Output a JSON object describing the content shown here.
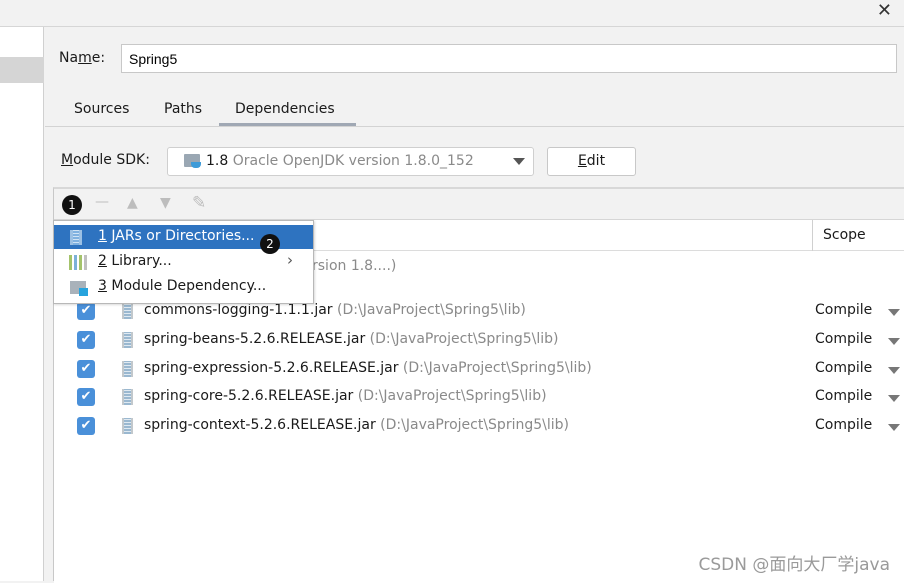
{
  "window": {
    "close_label": "✕"
  },
  "name": {
    "label_pre": "Na",
    "label_u": "m",
    "label_post": "e:",
    "value": "Spring5"
  },
  "tabs": [
    {
      "label": "Sources"
    },
    {
      "label": "Paths"
    },
    {
      "label": "Dependencies",
      "active": true
    }
  ],
  "sdk": {
    "label_u": "M",
    "label_rest": "odule SDK:",
    "version": "1.8",
    "description": " Oracle OpenJDK version 1.8.0_152",
    "edit_u": "E",
    "edit_rest": "dit"
  },
  "toolbar": {
    "add_badge": "1",
    "remove": "—",
    "up": "▲",
    "down": "▼",
    "edit": "✎"
  },
  "table": {
    "scope_header": "Scope",
    "sdk_row_fragment": "rsion 1.8....)"
  },
  "menu": {
    "items": [
      {
        "num": "1",
        "label": " JARs or Directories...",
        "badge": "2",
        "icon": "jar-icon"
      },
      {
        "num": "2",
        "label": " Library...",
        "submenu": true,
        "icon": "library-icon"
      },
      {
        "num": "3",
        "label": " Module Dependency...",
        "icon": "module-icon"
      }
    ]
  },
  "dependencies": [
    {
      "name": "commons-logging-1.1.1.jar",
      "path": " (D:\\JavaProject\\Spring5\\lib)",
      "scope": "Compile",
      "checked": true
    },
    {
      "name": "spring-beans-5.2.6.RELEASE.jar",
      "path": " (D:\\JavaProject\\Spring5\\lib)",
      "scope": "Compile",
      "checked": true
    },
    {
      "name": "spring-expression-5.2.6.RELEASE.jar",
      "path": " (D:\\JavaProject\\Spring5\\lib)",
      "scope": "Compile",
      "checked": true
    },
    {
      "name": "spring-core-5.2.6.RELEASE.jar",
      "path": " (D:\\JavaProject\\Spring5\\lib)",
      "scope": "Compile",
      "checked": true
    },
    {
      "name": "spring-context-5.2.6.RELEASE.jar",
      "path": " (D:\\JavaProject\\Spring5\\lib)",
      "scope": "Compile",
      "checked": true
    }
  ],
  "watermark": "CSDN @面向大厂学java",
  "colors": {
    "selection": "#2e73c0",
    "checkbox": "#4a90d9"
  }
}
